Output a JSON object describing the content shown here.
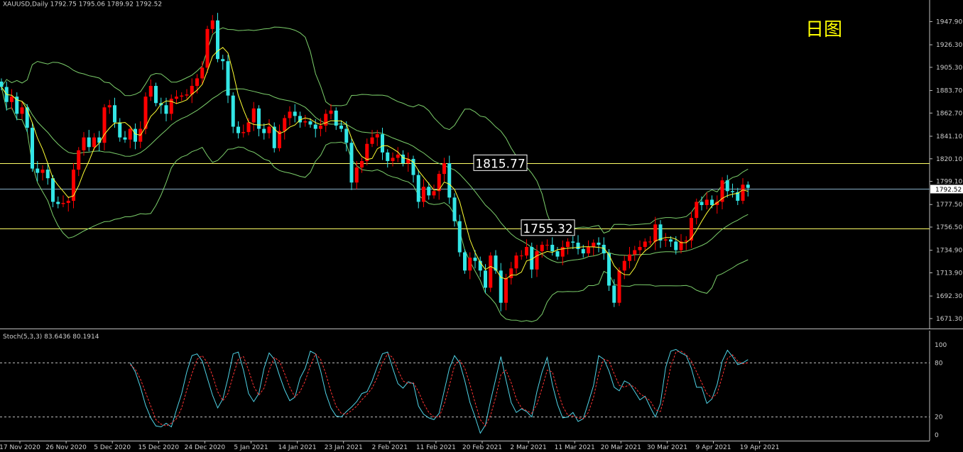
{
  "header": {
    "symbol_line": "XAUUSD,Daily  1792.75 1795.06 1789.92 1792.52"
  },
  "annotation": {
    "period_label": "日图"
  },
  "colors": {
    "background": "#000000",
    "bull": "#ff0000",
    "bear": "#33e6e6",
    "bands": "#7ccf6b",
    "ma": "#ffff33",
    "level": "#ffff66",
    "price_line": "#8ab0c8",
    "stoch_main": "#4fd3e6",
    "stoch_signal": "#ff3333",
    "axis": "#bfbfbf"
  },
  "chart_data": [
    {
      "type": "candlestick",
      "title": "",
      "ylim": [
        1662,
        1968
      ],
      "price_ticks": [
        "1947.90",
        "1926.30",
        "1905.30",
        "1883.70",
        "1862.70",
        "1841.10",
        "1820.10",
        "1799.10",
        "1777.50",
        "1756.50",
        "1734.90",
        "1713.90",
        "1692.30",
        "1671.30"
      ],
      "current_price": "1792.52",
      "levels": [
        {
          "value": 1815.77,
          "label": "1815.77"
        },
        {
          "value": 1755.32,
          "label": "1755.32"
        }
      ],
      "date_labels": [
        "17 Nov 2020",
        "26 Nov 2020",
        "5 Dec 2020",
        "15 Dec 2020",
        "24 Dec 2020",
        "5 Jan 2021",
        "14 Jan 2021",
        "23 Jan 2021",
        "2 Feb 2021",
        "11 Feb 2021",
        "20 Feb 2021",
        "2 Mar 2021",
        "11 Mar 2021",
        "20 Mar 2021",
        "30 Mar 2021",
        "9 Apr 2021",
        "19 Apr 2021"
      ],
      "close": [
        1887,
        1873,
        1878,
        1862,
        1868,
        1849,
        1811,
        1807,
        1810,
        1802,
        1780,
        1778,
        1779,
        1781,
        1810,
        1828,
        1840,
        1831,
        1840,
        1835,
        1868,
        1870,
        1854,
        1840,
        1838,
        1848,
        1836,
        1848,
        1878,
        1888,
        1872,
        1870,
        1862,
        1876,
        1878,
        1879,
        1880,
        1888,
        1895,
        1905,
        1941,
        1949,
        1913,
        1911,
        1879,
        1850,
        1844,
        1845,
        1854,
        1867,
        1848,
        1844,
        1850,
        1830,
        1846,
        1858,
        1864,
        1860,
        1854,
        1855,
        1852,
        1848,
        1851,
        1862,
        1865,
        1851,
        1848,
        1835,
        1798,
        1812,
        1818,
        1834,
        1840,
        1843,
        1826,
        1818,
        1821,
        1824,
        1816,
        1820,
        1805,
        1780,
        1794,
        1786,
        1790,
        1806,
        1816,
        1784,
        1762,
        1733,
        1716,
        1728,
        1725,
        1716,
        1700,
        1730,
        1716,
        1686,
        1709,
        1718,
        1730,
        1730,
        1738,
        1717,
        1734,
        1740,
        1740,
        1734,
        1729,
        1738,
        1743,
        1742,
        1736,
        1732,
        1738,
        1742,
        1740,
        1732,
        1702,
        1686,
        1716,
        1725,
        1731,
        1735,
        1738,
        1743,
        1743,
        1759,
        1744,
        1745,
        1743,
        1735,
        1743,
        1744,
        1765,
        1780,
        1777,
        1782,
        1777,
        1780,
        1800,
        1790,
        1789,
        1781,
        1796,
        1793
      ],
      "series": [
        {
          "name": "Stoch(5,3,3) 83.6436",
          "role": "main",
          "values": [
            80,
            70,
            53,
            33,
            19,
            10,
            9,
            13,
            9,
            28,
            46,
            70,
            88,
            90,
            82,
            63,
            44,
            30,
            40,
            63,
            90,
            92,
            72,
            46,
            37,
            46,
            74,
            91,
            84,
            66,
            50,
            38,
            42,
            63,
            74,
            93,
            90,
            71,
            46,
            30,
            21,
            20,
            26,
            31,
            37,
            46,
            48,
            60,
            76,
            90,
            92,
            74,
            57,
            52,
            59,
            57,
            32,
            23,
            19,
            17,
            24,
            49,
            74,
            88,
            80,
            60,
            36,
            20,
            2,
            11,
            38,
            62,
            87,
            61,
            36,
            25,
            29,
            26,
            20,
            48,
            70,
            86,
            56,
            34,
            19,
            20,
            25,
            15,
            18,
            36,
            55,
            88,
            84,
            71,
            53,
            49,
            60,
            57,
            48,
            39,
            43,
            31,
            20,
            35,
            75,
            93,
            95,
            91,
            88,
            74,
            53,
            53,
            35,
            40,
            56,
            82,
            94,
            87,
            78,
            80,
            83.6436
          ]
        },
        {
          "name": "80.1914",
          "role": "signal",
          "values": [
            78,
            73,
            62,
            47,
            32,
            17,
            12,
            10,
            13,
            18,
            30,
            50,
            68,
            84,
            88,
            80,
            66,
            48,
            38,
            46,
            66,
            84,
            87,
            72,
            54,
            44,
            52,
            72,
            86,
            82,
            68,
            53,
            42,
            48,
            60,
            77,
            90,
            84,
            68,
            48,
            32,
            24,
            23,
            27,
            32,
            39,
            45,
            52,
            64,
            80,
            90,
            86,
            72,
            60,
            57,
            58,
            48,
            35,
            25,
            20,
            20,
            34,
            55,
            77,
            83,
            74,
            56,
            36,
            17,
            10,
            22,
            42,
            67,
            72,
            58,
            40,
            30,
            27,
            24,
            34,
            52,
            72,
            70,
            50,
            32,
            22,
            21,
            19,
            18,
            25,
            42,
            68,
            84,
            82,
            68,
            55,
            53,
            56,
            53,
            46,
            42,
            38,
            28,
            26,
            48,
            76,
            92,
            93,
            89,
            82,
            70,
            58,
            46,
            41,
            46,
            65,
            85,
            89,
            82,
            79,
            80.1914
          ]
        }
      ]
    },
    {
      "type": "line",
      "title": "Stoch(5,3,3) 83.6436 80.1914",
      "ylim": [
        0,
        100
      ],
      "y_ticks": [
        "100",
        "80",
        "20",
        "0"
      ],
      "levels": [
        80,
        20
      ]
    }
  ]
}
